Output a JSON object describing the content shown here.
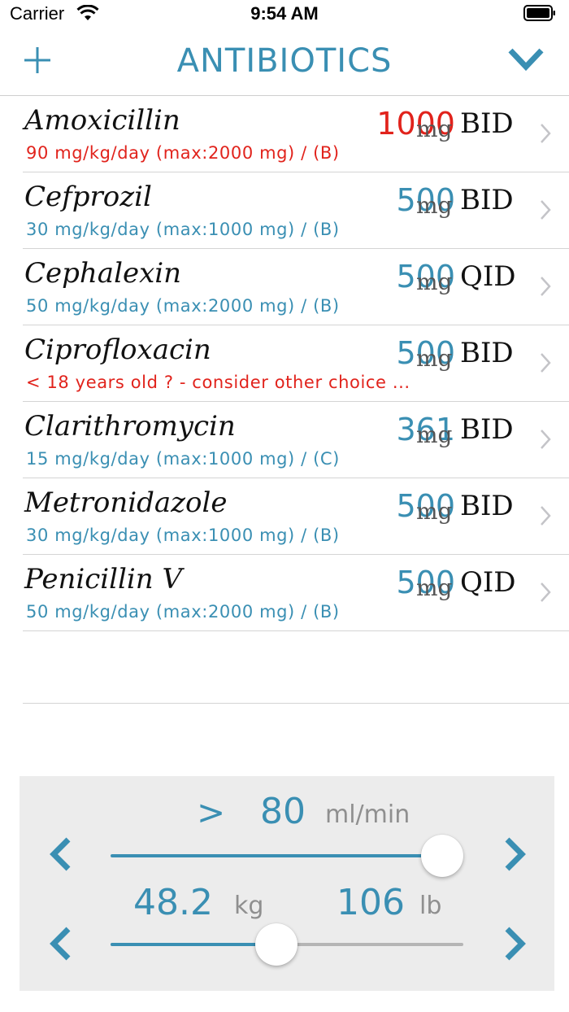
{
  "status_bar": {
    "carrier": "Carrier",
    "time": "9:54 AM"
  },
  "nav": {
    "title": "ANTIBIOTICS",
    "add_icon": "plus-icon",
    "menu_icon": "chevron-down-icon"
  },
  "colors": {
    "accent": "#3a8fb3",
    "warning": "#e1231c",
    "panel": "#ececec"
  },
  "drugs": [
    {
      "name": "Amoxicillin",
      "dose": "1000",
      "unit": "mg",
      "freq": "BID",
      "detail": "90 mg/kg/day (max:2000 mg) / (B)",
      "dose_color": "red",
      "detail_color": "red"
    },
    {
      "name": "Cefprozil",
      "dose": "500",
      "unit": "mg",
      "freq": "BID",
      "detail": "30 mg/kg/day (max:1000 mg) / (B)",
      "dose_color": "blue",
      "detail_color": "blue"
    },
    {
      "name": "Cephalexin",
      "dose": "500",
      "unit": "mg",
      "freq": "QID",
      "detail": "50 mg/kg/day (max:2000 mg) / (B)",
      "dose_color": "blue",
      "detail_color": "blue"
    },
    {
      "name": "Ciprofloxacin",
      "dose": "500",
      "unit": "mg",
      "freq": "BID",
      "detail": "< 18 years old ? - consider other choice ...",
      "dose_color": "blue",
      "detail_color": "red"
    },
    {
      "name": "Clarithromycin",
      "dose": "361",
      "unit": "mg",
      "freq": "BID",
      "detail": "15 mg/kg/day (max:1000 mg) / (C)",
      "dose_color": "blue",
      "detail_color": "blue"
    },
    {
      "name": "Metronidazole",
      "dose": "500",
      "unit": "mg",
      "freq": "BID",
      "detail": "30 mg/kg/day (max:1000 mg) / (B)",
      "dose_color": "blue",
      "detail_color": "blue"
    },
    {
      "name": "Penicillin V",
      "dose": "500",
      "unit": "mg",
      "freq": "QID",
      "detail": "50 mg/kg/day (max:2000 mg) / (B)",
      "dose_color": "blue",
      "detail_color": "blue"
    }
  ],
  "renal": {
    "comparator": ">",
    "value": "80",
    "unit": "ml/min",
    "slider_fraction": 0.94
  },
  "weight": {
    "kg_value": "48.2",
    "kg_unit": "kg",
    "lb_value": "106",
    "lb_unit": "lb",
    "slider_fraction": 0.47
  }
}
